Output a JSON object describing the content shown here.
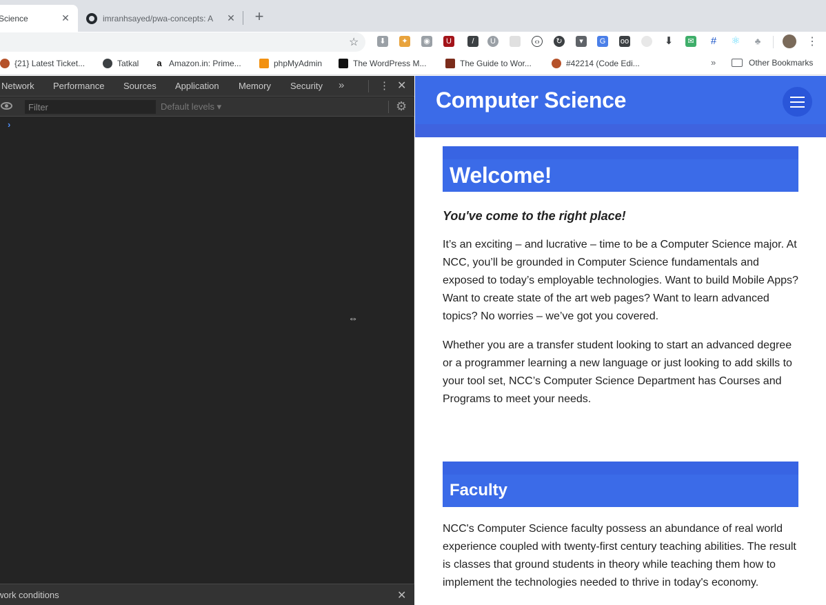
{
  "tabs": [
    {
      "title": "Science",
      "active": true
    },
    {
      "title": "imranhsayed/pwa-concepts: A",
      "active": false
    }
  ],
  "toolbar": {
    "extensions": [
      "download-ext-icon",
      "color-picker-ext-icon",
      "camera-ext-icon",
      "ublock-ext-icon",
      "eyedropper-ext-icon",
      "u-ext-icon",
      "grid-ext-icon",
      "code-ext-icon",
      "refresh-ext-icon",
      "shield-ext-icon",
      "translate-ext-icon",
      "ooo-ext-icon",
      "timer-ext-icon",
      "download-arrow-icon",
      "inbox-ext-icon",
      "frame-ext-icon",
      "react-ext-icon",
      "tree-ext-icon"
    ]
  },
  "bookmarks": {
    "items": [
      {
        "label": "{21} Latest Ticket...",
        "color": "#b5522a"
      },
      {
        "label": "Tatkal",
        "color": "#3c4043"
      },
      {
        "label": "Amazon.in: Prime...",
        "color": "#111111"
      },
      {
        "label": "phpMyAdmin",
        "color": "#f29111"
      },
      {
        "label": "The WordPress M...",
        "color": "#111111"
      },
      {
        "label": "The Guide to Wor...",
        "color": "#7b2c1b"
      },
      {
        "label": "#42214 (Code Edi...",
        "color": "#b5522a"
      }
    ],
    "more": "»",
    "other": "Other Bookmarks"
  },
  "devtools": {
    "tabs": [
      "Network",
      "Performance",
      "Sources",
      "Application",
      "Memory",
      "Security"
    ],
    "more": "»",
    "filter_placeholder": "Filter",
    "levels": "Default levels ▾",
    "prompt": "›",
    "drawer_title": "work conditions"
  },
  "site": {
    "title": "Computer Science",
    "welcome_heading": "Welcome!",
    "tagline": "You've come to the right place!",
    "paragraph_1": "It’s an exciting – and lucrative – time to be a Computer Science major. At NCC, you’ll be grounded in Computer Science fundamentals and exposed to today’s employable technologies. Want to build Mobile Apps? Want to create state of the art web pages? Want to learn advanced topics? No worries – we’ve got you covered.",
    "paragraph_2": "Whether you are a transfer student looking to start an advanced degree or a programmer learning a new language or just looking to add skills to your tool set, NCC’s Computer Science Department has Courses and Programs to meet your needs.",
    "faculty_heading": "Faculty",
    "paragraph_3": "NCC's Computer Science faculty possess an abundance of real world experience coupled with twenty-first century teaching abilities. The result is classes that ground students in theory while teaching them how to implement the technologies needed to thrive in today's economy."
  },
  "colors": {
    "brand_blue": "#3b6be8",
    "devtools_bg": "#242424"
  }
}
